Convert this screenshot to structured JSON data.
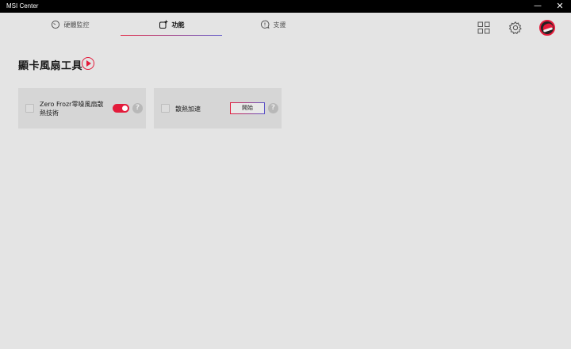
{
  "window": {
    "title": "MSI Center",
    "minimize": "—",
    "close": "✕"
  },
  "tabs": [
    {
      "label": "硬體監控",
      "icon": "gauge-icon"
    },
    {
      "label": "功能",
      "icon": "add-feature-icon",
      "active": true
    },
    {
      "label": "支援",
      "icon": "chat-support-icon"
    }
  ],
  "header_icons": [
    "grid-apps-icon",
    "gear-icon",
    "avatar"
  ],
  "section": {
    "title": "顯卡風扇工具",
    "icon": "play-icon"
  },
  "cards": [
    {
      "label": "Zero Frozr零噪風扇散熱技術",
      "control": "toggle",
      "toggle_on": true,
      "help": "?"
    },
    {
      "label": "散熱加速",
      "control": "button",
      "button_label": "開始",
      "help": "?"
    }
  ],
  "colors": {
    "accent_red": "#e31b3b",
    "accent_purple": "#5a52c9",
    "background": "#e4e4e4",
    "card": "#d6d6d6"
  }
}
